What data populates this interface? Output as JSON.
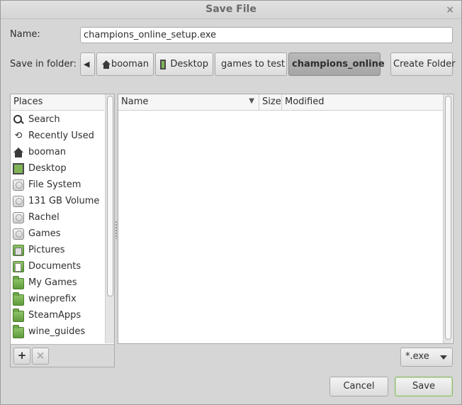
{
  "window": {
    "title": "Save File",
    "close_glyph": "×"
  },
  "name_label": "Name:",
  "name_value": "champions_online_setup.exe",
  "folder_label": "Save in folder:",
  "path": {
    "back_glyph": "◀",
    "segments": [
      "booman",
      "Desktop",
      "games to test",
      "champions_online"
    ],
    "create_folder": "Create Folder"
  },
  "places": {
    "header": "Places",
    "items": [
      {
        "label": "Search",
        "icon": "search-icon"
      },
      {
        "label": "Recently Used",
        "icon": "recent-icon"
      },
      {
        "label": "booman",
        "icon": "home-icon"
      },
      {
        "label": "Desktop",
        "icon": "desktop-icon"
      },
      {
        "label": "File System",
        "icon": "drive-icon"
      },
      {
        "label": "131 GB Volume",
        "icon": "drive-icon"
      },
      {
        "label": "Rachel",
        "icon": "drive-icon"
      },
      {
        "label": "Games",
        "icon": "drive-icon"
      },
      {
        "label": "Pictures",
        "icon": "pictures-folder-icon"
      },
      {
        "label": "Documents",
        "icon": "documents-folder-icon"
      },
      {
        "label": "My Games",
        "icon": "folder-icon"
      },
      {
        "label": "wineprefix",
        "icon": "folder-icon"
      },
      {
        "label": "SteamApps",
        "icon": "folder-icon"
      },
      {
        "label": "wine_guides",
        "icon": "folder-icon"
      }
    ],
    "add_glyph": "+",
    "remove_glyph": "×"
  },
  "files": {
    "columns": {
      "name": "Name",
      "size": "Size",
      "modified": "Modified"
    },
    "sort_glyph": "▼"
  },
  "filter": {
    "value": "*.exe"
  },
  "buttons": {
    "cancel": "Cancel",
    "save": "Save"
  },
  "colors": {
    "accent_green": "#7fb356",
    "active_segment": "#a6a6a6",
    "default_border": "#8bb86a"
  }
}
